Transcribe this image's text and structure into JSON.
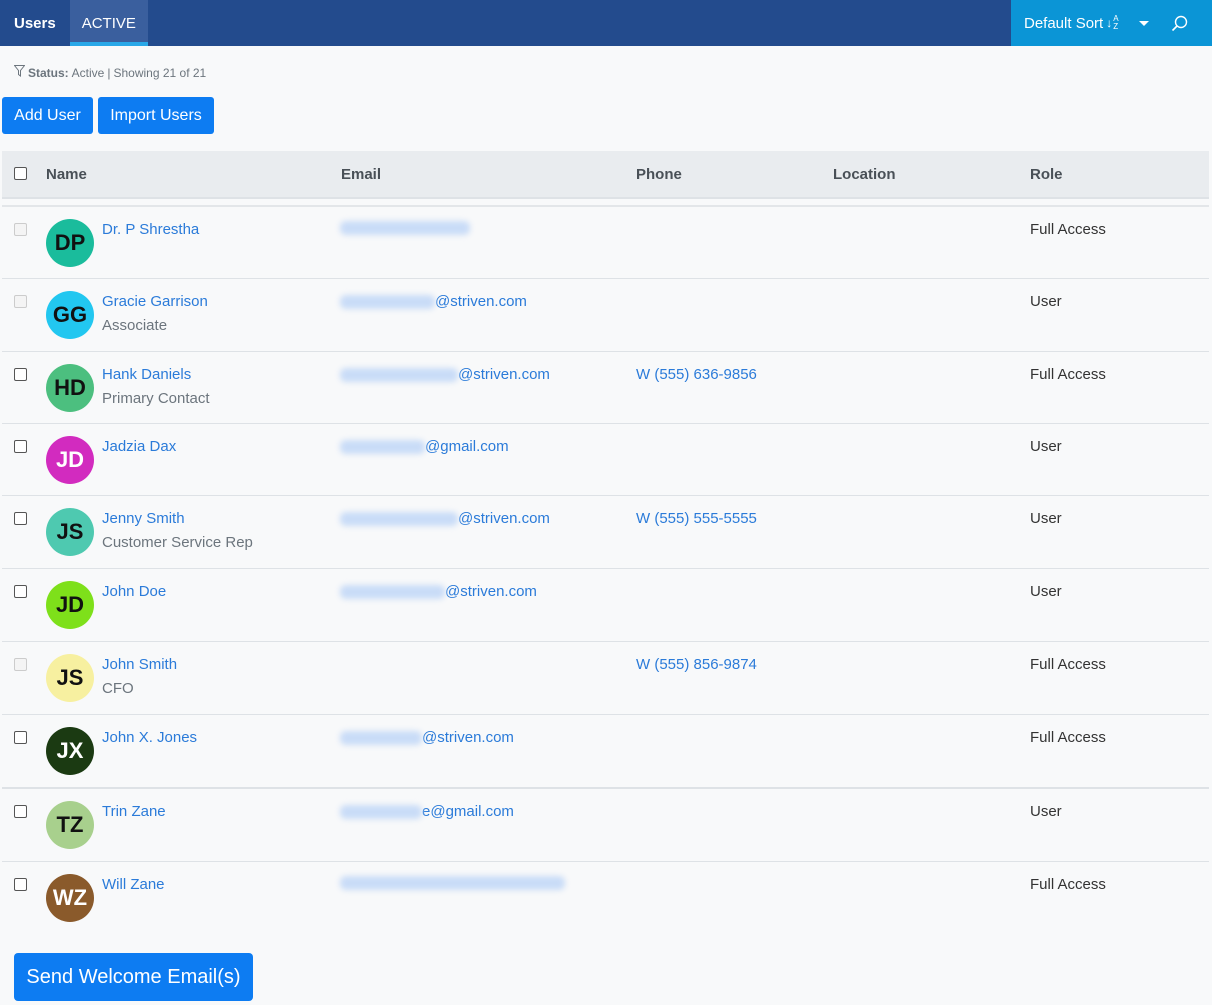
{
  "header": {
    "title": "Users",
    "active_tab": "ACTIVE",
    "sort_label": "Default Sort",
    "sort_icon": "sort-alpha-down-icon",
    "dropdown_icon": "caret-down-icon",
    "search_icon": "search-icon"
  },
  "filter": {
    "icon": "filter-icon",
    "label": "Status:",
    "value": "Active",
    "separator": "|",
    "showing": "Showing 21 of 21"
  },
  "actions": {
    "add_user": "Add User",
    "import_users": "Import Users",
    "send_welcome": "Send Welcome Email(s)"
  },
  "table": {
    "columns": [
      "Name",
      "Email",
      "Phone",
      "Location",
      "Role"
    ],
    "rows": [
      {
        "initials": "DP",
        "name": "Dr. P Shrestha",
        "title": "",
        "email_visible": "",
        "phone": "",
        "location": "",
        "role": "Full Access",
        "avatar_bg": "#1abc9c",
        "avatar_fg": "#111111",
        "checkbox_disabled": true
      },
      {
        "initials": "GG",
        "name": "Gracie Garrison",
        "title": "Associate",
        "email_visible": "@striven.com",
        "phone": "",
        "location": "",
        "role": "User",
        "avatar_bg": "#22c7f0",
        "avatar_fg": "#111111",
        "checkbox_disabled": true
      },
      {
        "initials": "HD",
        "name": "Hank Daniels",
        "title": "Primary Contact",
        "email_visible": "@striven.com",
        "phone": "W (555) 636-9856",
        "location": "",
        "role": "Full Access",
        "avatar_bg": "#4cbf7f",
        "avatar_fg": "#111111",
        "checkbox_disabled": false
      },
      {
        "initials": "JD",
        "name": "Jadzia Dax",
        "title": "",
        "email_visible": "@gmail.com",
        "phone": "",
        "location": "",
        "role": "User",
        "avatar_bg": "#d22bbf",
        "avatar_fg": "#ffffff",
        "checkbox_disabled": false
      },
      {
        "initials": "JS",
        "name": "Jenny Smith",
        "title": "Customer Service Rep",
        "email_visible": "@striven.com",
        "phone": "W (555) 555-5555",
        "location": "",
        "role": "User",
        "avatar_bg": "#4ec9b0",
        "avatar_fg": "#111111",
        "checkbox_disabled": false
      },
      {
        "initials": "JD",
        "name": "John Doe",
        "title": "",
        "email_visible": "@striven.com",
        "phone": "",
        "location": "",
        "role": "User",
        "avatar_bg": "#7ee01a",
        "avatar_fg": "#111111",
        "checkbox_disabled": false
      },
      {
        "initials": "JS",
        "name": "John Smith",
        "title": "CFO",
        "email_visible": "",
        "phone": "W (555) 856-9874",
        "location": "",
        "role": "Full Access",
        "avatar_bg": "#f7f0a0",
        "avatar_fg": "#111111",
        "checkbox_disabled": true
      },
      {
        "initials": "JX",
        "name": "John X. Jones",
        "title": "",
        "email_visible": "@striven.com",
        "phone": "",
        "location": "",
        "role": "Full Access",
        "avatar_bg": "#1b3a12",
        "avatar_fg": "#ffffff",
        "checkbox_disabled": false
      },
      {
        "initials": "TZ",
        "name": "Trin Zane",
        "title": "",
        "email_visible": "e@gmail.com",
        "phone": "",
        "location": "",
        "role": "User",
        "avatar_bg": "#a8d08d",
        "avatar_fg": "#111111",
        "checkbox_disabled": false
      },
      {
        "initials": "WZ",
        "name": "Will Zane",
        "title": "",
        "email_visible": "",
        "phone": "",
        "location": "",
        "role": "Full Access",
        "avatar_bg": "#8a5a2b",
        "avatar_fg": "#ffffff",
        "checkbox_disabled": false
      }
    ]
  },
  "colors": {
    "topbar": "#234b8d",
    "topbar_right": "#0b95d6",
    "primary_button": "#0d7cf2",
    "link": "#2b7bd9"
  }
}
